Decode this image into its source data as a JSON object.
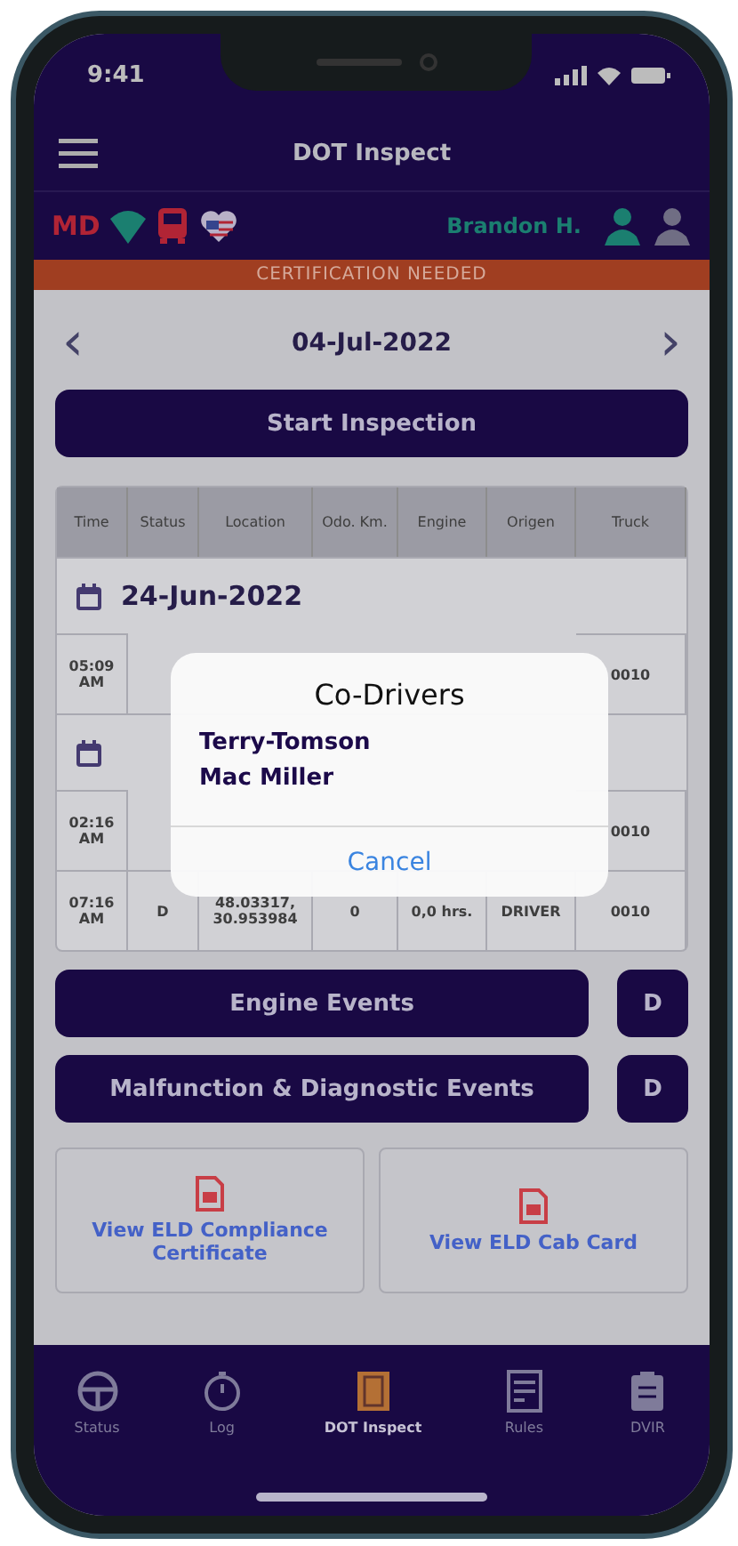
{
  "status_bar": {
    "time": "9:41"
  },
  "header": {
    "title": "DOT Inspect",
    "state_code": "MD",
    "driver": "Brandon H."
  },
  "banner": {
    "text": "CERTIFICATION NEEDED"
  },
  "date_nav": {
    "date": "04-Jul-2022",
    "prev": "‹",
    "next": "›"
  },
  "start_button": "Start Inspection",
  "table": {
    "columns": [
      "Time",
      "Status",
      "Location",
      "Odo. Km.",
      "Engine",
      "Origen",
      "Truck"
    ],
    "groups": [
      {
        "date": "24-Jun-2022",
        "rows": [
          {
            "cells": [
              "05:09 AM",
              null,
              null,
              null,
              null,
              null,
              "0010"
            ]
          }
        ]
      },
      {
        "rows": [
          {
            "cells": [
              "02:16 AM",
              null,
              null,
              null,
              null,
              null,
              "0010"
            ]
          },
          {
            "cells": [
              "07:16 AM",
              "D",
              "48.03317, 30.953984",
              "0",
              "0,0 hrs.",
              "DRIVER",
              "0010"
            ]
          }
        ]
      }
    ]
  },
  "event_buttons": [
    {
      "label": "Engine Events",
      "badge": "D"
    },
    {
      "label": "Malfunction & Diagnostic Events",
      "badge": "D"
    }
  ],
  "cards": [
    {
      "label": "View ELD Compliance Certificate"
    },
    {
      "label": "View ELD Cab Card"
    }
  ],
  "tabs": [
    {
      "label": "Status",
      "kind": "wheel",
      "selected": false
    },
    {
      "label": "Log",
      "kind": "timer",
      "selected": false
    },
    {
      "label": "DOT Inspect",
      "kind": "book",
      "selected": true
    },
    {
      "label": "Rules",
      "kind": "rules",
      "selected": false
    },
    {
      "label": "DVIR",
      "kind": "clipboard",
      "selected": false
    }
  ],
  "dialog": {
    "title": "Co-Drivers",
    "names": [
      "Terry-Tomson",
      "Mac Miller"
    ],
    "button": "Cancel"
  }
}
